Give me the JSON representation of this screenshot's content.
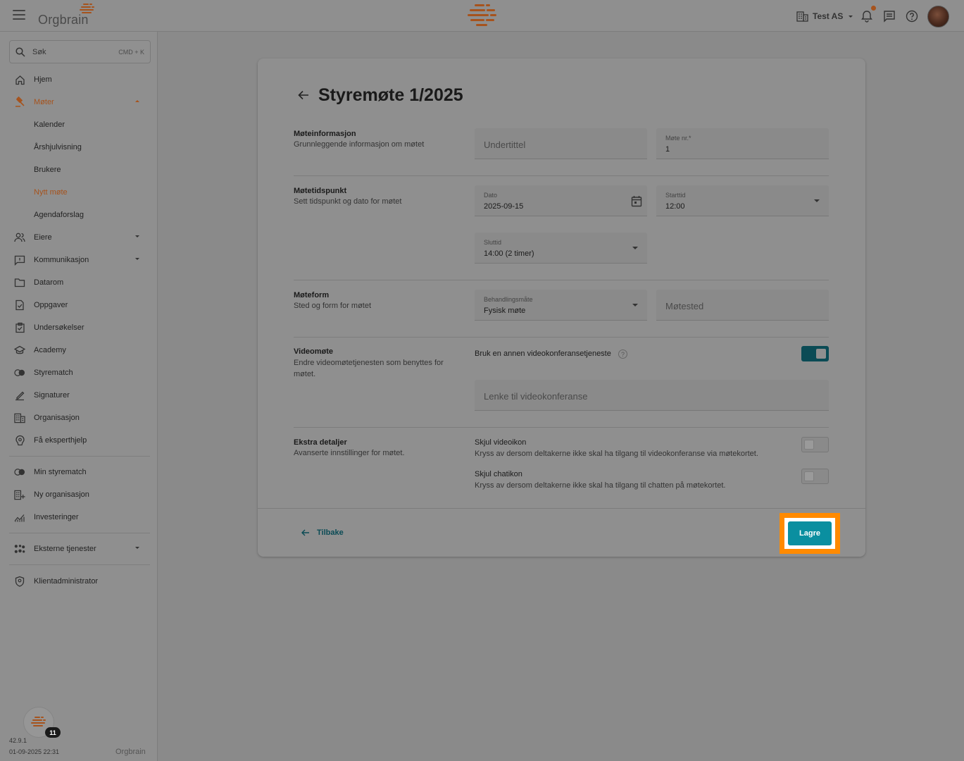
{
  "app": {
    "logo_text": "Orgbrain",
    "org_name": "Test AS"
  },
  "colors": {
    "accent": "#a6531d",
    "teal": "#0a8fa0",
    "highlight": "#ff8a00"
  },
  "search": {
    "label": "Søk",
    "shortcut": "CMD + K"
  },
  "sidebar": {
    "items": [
      {
        "label": "Hjem",
        "icon": "home-icon"
      },
      {
        "label": "Møter",
        "icon": "gavel-icon"
      },
      {
        "label": "Eiere",
        "icon": "owners-icon"
      },
      {
        "label": "Kommunikasjon",
        "icon": "message-icon"
      },
      {
        "label": "Datarom",
        "icon": "folder-icon"
      },
      {
        "label": "Oppgaver",
        "icon": "task-icon"
      },
      {
        "label": "Undersøkelser",
        "icon": "survey-icon"
      },
      {
        "label": "Academy",
        "icon": "school-icon"
      },
      {
        "label": "Styrematch",
        "icon": "match-icon"
      },
      {
        "label": "Signaturer",
        "icon": "signature-icon"
      },
      {
        "label": "Organisasjon",
        "icon": "building-icon"
      },
      {
        "label": "Få eksperthjelp",
        "icon": "expert-icon"
      },
      {
        "label": "Min styrematch",
        "icon": "match-icon"
      },
      {
        "label": "Ny organisasjon",
        "icon": "building-add-icon"
      },
      {
        "label": "Investeringer",
        "icon": "chart-icon"
      },
      {
        "label": "Eksterne tjenester",
        "icon": "apps-icon"
      },
      {
        "label": "Klientadministrator",
        "icon": "shield-icon"
      }
    ],
    "meeting_sub": [
      "Kalender",
      "Årshjulvisning",
      "Brukere",
      "Nytt møte",
      "Agendaforslag"
    ],
    "version": "42.9.1",
    "timestamp": "01-09-2025 22:31",
    "notification_count": "11"
  },
  "page": {
    "title": "Styremøte 1/2025",
    "sections": {
      "info": {
        "title": "Møteinformasjon",
        "desc": "Grunnleggende informasjon om møtet"
      },
      "time": {
        "title": "Møtetidspunkt",
        "desc": "Sett tidspunkt og dato for møtet"
      },
      "form": {
        "title": "Møteform",
        "desc": "Sted og form for møtet"
      },
      "video": {
        "title": "Videomøte",
        "desc": "Endre videomøtetjenesten som benyttes for møtet."
      },
      "extra": {
        "title": "Ekstra detaljer",
        "desc": "Avanserte innstillinger for møtet."
      }
    },
    "fields": {
      "subtitle_placeholder": "Undertittel",
      "meeting_no_label": "Møte nr.*",
      "meeting_no_value": "1",
      "date_label": "Dato",
      "date_value": "2025-09-15",
      "start_label": "Starttid",
      "start_value": "12:00",
      "end_label": "Sluttid",
      "end_value": "14:00 (2 timer)",
      "method_label": "Behandlingsmåte",
      "method_value": "Fysisk møte",
      "location_placeholder": "Møtested",
      "video_link_placeholder": "Lenke til videokonferanse"
    },
    "options": {
      "other_video_label": "Bruk en annen videokonferansetjeneste",
      "hide_video_label": "Skjul videoikon",
      "hide_video_desc": "Kryss av dersom deltakerne ikke skal ha tilgang til videokonferanse via møtekortet.",
      "hide_chat_label": "Skjul chatikon",
      "hide_chat_desc": "Kryss av dersom deltakerne ikke skal ha tilgang til chatten på møtekortet."
    },
    "toggles": {
      "other_video": true,
      "hide_video": false,
      "hide_chat": false
    },
    "footer": {
      "back_label": "Tilbake",
      "save_label": "Lagre"
    }
  }
}
